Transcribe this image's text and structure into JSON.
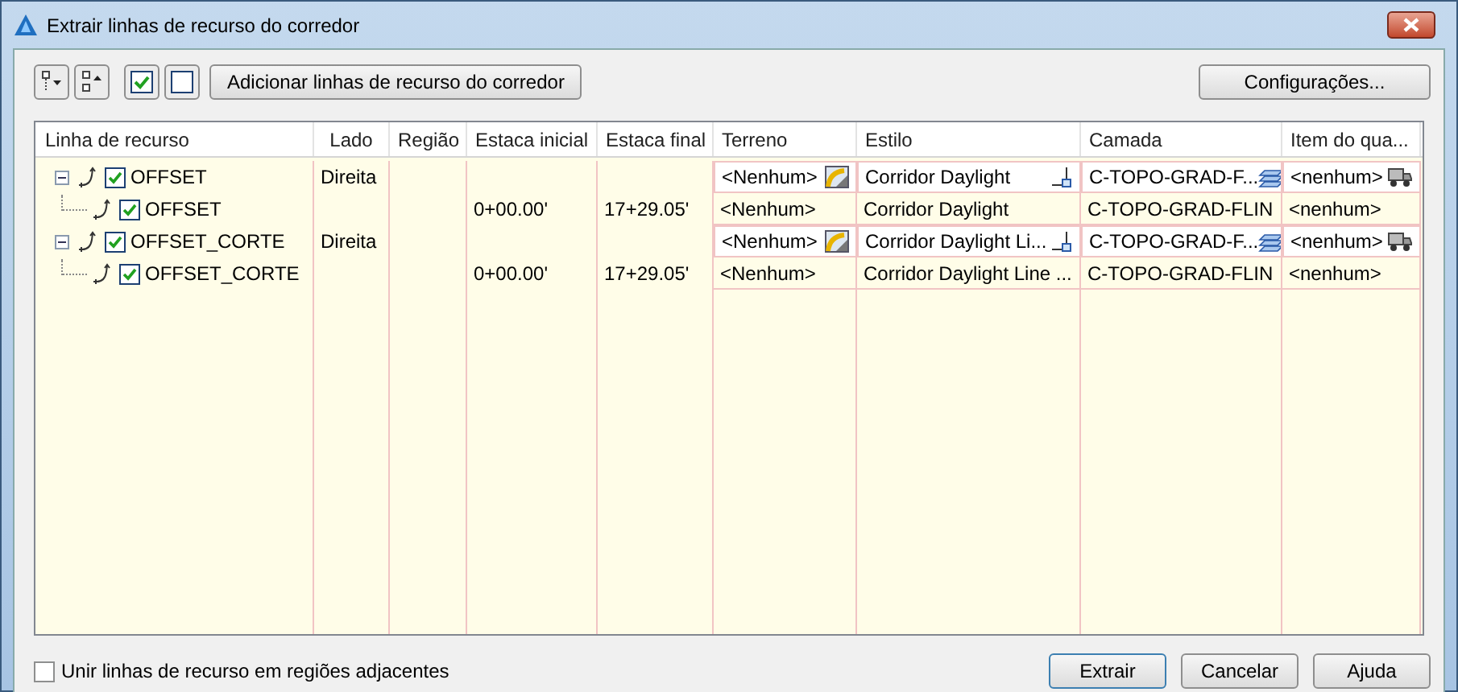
{
  "window": {
    "title": "Extrair linhas de recurso do corredor"
  },
  "toolbar": {
    "add_button": "Adicionar linhas de recurso do corredor",
    "settings_button": "Configurações..."
  },
  "table": {
    "columns": [
      "Linha de recurso",
      "Lado",
      "Região",
      "Estaca inicial",
      "Estaca final",
      "Terreno",
      "Estilo",
      "Camada",
      "Item do qua..."
    ],
    "rows": [
      {
        "feature_line": "OFFSET",
        "checked": true,
        "expanded": true,
        "side": "Direita",
        "surface": "<Nenhum>",
        "style": "Corridor Daylight",
        "layer": "C-TOPO-GRAD-F...",
        "pay_item": "<nenhum>",
        "children": [
          {
            "feature_line": "OFFSET",
            "checked": true,
            "start_station": "0+00.00'",
            "end_station": "17+29.05'",
            "surface": "<Nenhum>",
            "style": "Corridor Daylight",
            "layer": "C-TOPO-GRAD-FLIN",
            "pay_item": "<nenhum>"
          }
        ]
      },
      {
        "feature_line": "OFFSET_CORTE",
        "checked": true,
        "expanded": true,
        "side": "Direita",
        "surface": "<Nenhum>",
        "style": "Corridor Daylight Li...",
        "layer": "C-TOPO-GRAD-F...",
        "pay_item": "<nenhum>",
        "children": [
          {
            "feature_line": "OFFSET_CORTE",
            "checked": true,
            "start_station": "0+00.00'",
            "end_station": "17+29.05'",
            "surface": "<Nenhum>",
            "style": "Corridor Daylight Line ...",
            "layer": "C-TOPO-GRAD-FLIN",
            "pay_item": "<nenhum>"
          }
        ]
      }
    ]
  },
  "footer": {
    "merge_option": {
      "label": "Unir linhas de recurso em regiões adjacentes",
      "checked": false
    },
    "buttons": [
      {
        "label": "Extrair",
        "default": true
      },
      {
        "label": "Cancelar",
        "default": false
      },
      {
        "label": "Ajuda",
        "default": false
      }
    ]
  }
}
